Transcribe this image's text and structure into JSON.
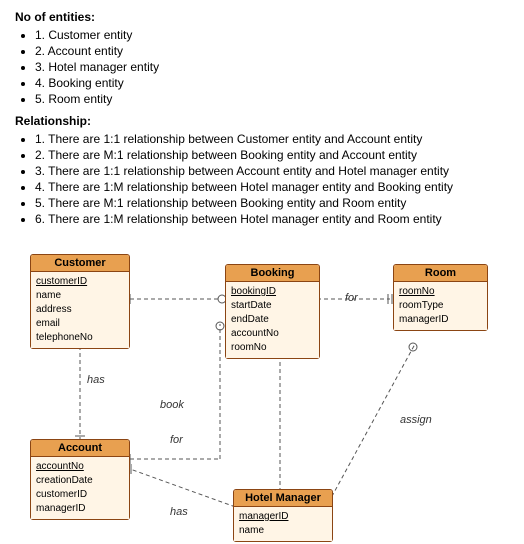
{
  "sections": {
    "entities_title": "No of entities:",
    "entities": [
      "1. Customer entity",
      "2. Account entity",
      "3. Hotel manager entity",
      "4. Booking entity",
      "5. Room entity"
    ],
    "relationships_title": "Relationship:",
    "relationships": [
      "1. There are 1:1 relationship between Customer entity and Account entity",
      "2. There are M:1 relationship between Booking entity and Account entity",
      "3. There are 1:1 relationship between Account entity and Hotel manager entity",
      "4. There are 1:M relationship between Hotel manager entity and Booking entity",
      "5. There are M:1 relationship between Booking entity and Room entity",
      "6. There are 1:M relationship between Hotel manager entity and Room entity"
    ]
  },
  "entities": {
    "customer": {
      "name": "Customer",
      "attrs": [
        "customerID",
        "name",
        "address",
        "email",
        "telephoneNo"
      ]
    },
    "account": {
      "name": "Account",
      "attrs": [
        "accountNo",
        "creationDate",
        "customerID",
        "managerID"
      ]
    },
    "booking": {
      "name": "Booking",
      "attrs": [
        "bookingID",
        "startDate",
        "endDate",
        "accountNo",
        "roomNo"
      ]
    },
    "room": {
      "name": "Room",
      "attrs": [
        "roomNo",
        "roomType",
        "managerID"
      ]
    },
    "hotel_manager": {
      "name": "Hotel Manager",
      "attrs": [
        "managerID",
        "name"
      ]
    }
  },
  "labels": {
    "has1": "has",
    "book": "book",
    "for1": "for",
    "for2": "for",
    "has2": "has",
    "assign": "assign"
  }
}
